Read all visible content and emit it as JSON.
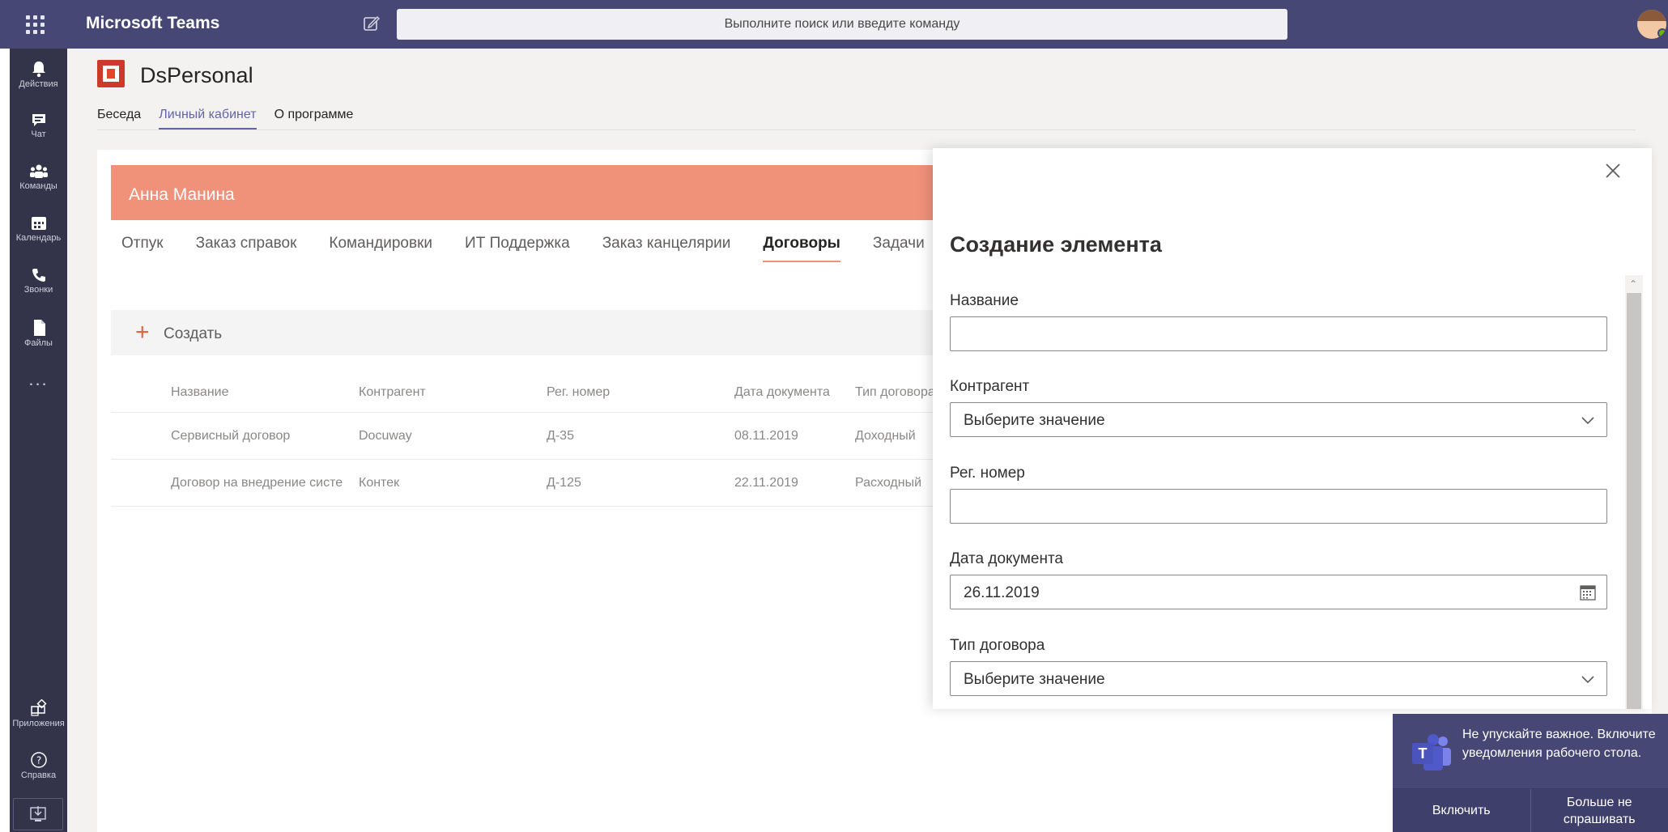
{
  "window": {
    "app_name": "Microsoft Teams"
  },
  "search": {
    "placeholder": "Выполните поиск или введите команду"
  },
  "rail": {
    "items": [
      {
        "label": "Действия",
        "icon": "bell-icon"
      },
      {
        "label": "Чат",
        "icon": "chat-icon"
      },
      {
        "label": "Команды",
        "icon": "teams-icon"
      },
      {
        "label": "Календарь",
        "icon": "calendar-icon"
      },
      {
        "label": "Звонки",
        "icon": "phone-icon"
      },
      {
        "label": "Файлы",
        "icon": "file-icon"
      }
    ],
    "more": "...",
    "apps_label": "Приложения",
    "help_label": "Справка"
  },
  "app": {
    "title": "DsPersonal",
    "tabs": [
      "Беседа",
      "Личный кабинет",
      "О программе"
    ],
    "active_tab": "Личный кабинет"
  },
  "profile": {
    "name": "Анна Манина"
  },
  "sections": {
    "tabs": [
      "Отпук",
      "Заказ справок",
      "Командировки",
      "ИТ Поддержка",
      "Заказ канцелярии",
      "Договоры",
      "Задачи"
    ],
    "active": "Договоры"
  },
  "toolbar": {
    "create_label": "Создать"
  },
  "table": {
    "headers": [
      "Название",
      "Контрагент",
      "Рег. номер",
      "Дата документа",
      "Тип договора"
    ],
    "rows": [
      [
        "Сервисный договор",
        "Docuway",
        "Д-35",
        "08.11.2019",
        "Доходный"
      ],
      [
        "Договор на внедрение систе",
        "Контек",
        "Д-125",
        "22.11.2019",
        "Расходный"
      ]
    ]
  },
  "panel": {
    "title": "Создание элемента",
    "fields": {
      "name": {
        "label": "Название",
        "value": ""
      },
      "counterparty": {
        "label": "Контрагент",
        "value": "Выберите значение"
      },
      "reg_number": {
        "label": "Рег. номер",
        "value": ""
      },
      "doc_date": {
        "label": "Дата документа",
        "value": "26.11.2019"
      },
      "contract_type": {
        "label": "Тип договора",
        "value": "Выберите значение"
      }
    }
  },
  "toast": {
    "text": "Не упускайте важное. Включите уведомления рабочего стола.",
    "enable_label": "Включить",
    "dismiss_label": "Больше не спрашивать"
  },
  "colors": {
    "teams_purple": "#464775",
    "rail_dark": "#33344a",
    "accent": "#6264a7",
    "banner": "#f0917a",
    "create_plus": "#e8643f"
  }
}
